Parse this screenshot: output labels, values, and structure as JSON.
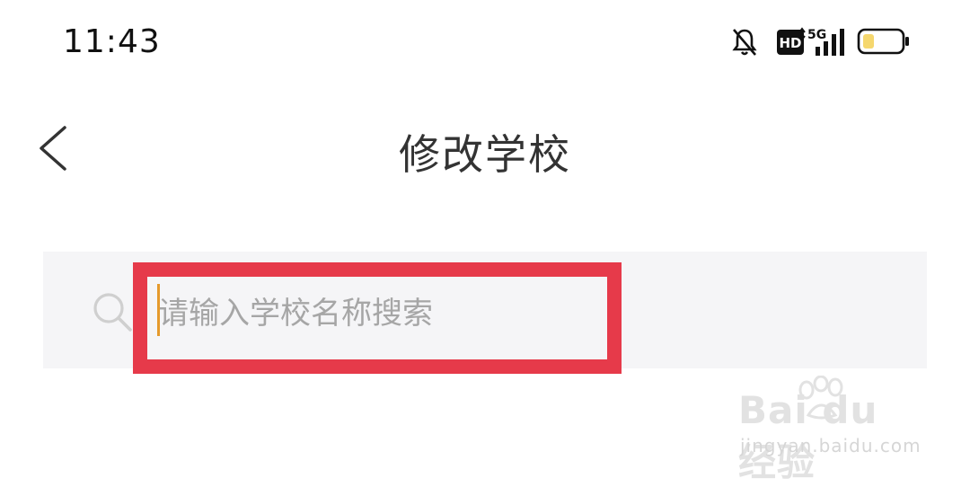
{
  "status_bar": {
    "time": "11:43",
    "network": "5G",
    "hd_badge": "HD",
    "icons": [
      "bell-off-icon",
      "hd-icon",
      "signal-icon",
      "battery-icon"
    ]
  },
  "nav": {
    "back_icon": "chevron-left-icon",
    "title": "修改学校"
  },
  "search": {
    "icon": "search-icon",
    "placeholder": "请输入学校名称搜索",
    "value": ""
  },
  "annotation": {
    "color": "#e63a4a"
  },
  "watermark": {
    "brand": "Bai du 经验",
    "url": "jingyan.baidu.com"
  },
  "colors": {
    "caret": "#e59a2c",
    "battery_fill": "#f5d76e",
    "search_bg": "#f5f5f7"
  }
}
